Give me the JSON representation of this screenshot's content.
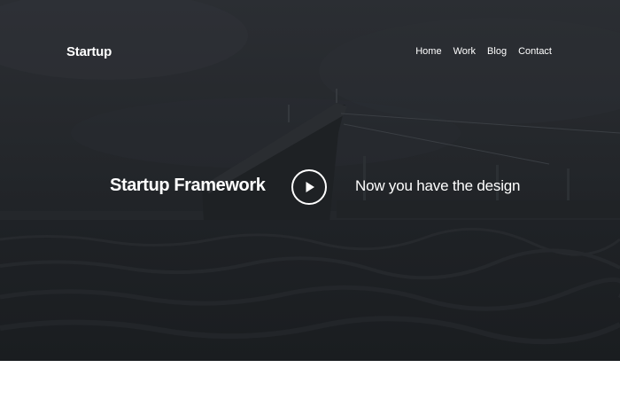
{
  "header": {
    "brand": "Startup",
    "nav": [
      {
        "label": "Home"
      },
      {
        "label": "Work"
      },
      {
        "label": "Blog"
      },
      {
        "label": "Contact"
      }
    ]
  },
  "hero": {
    "headline": "Startup Framework",
    "tagline": "Now you have the design",
    "play_icon": "play-icon",
    "overlay_color": "#23262a"
  }
}
